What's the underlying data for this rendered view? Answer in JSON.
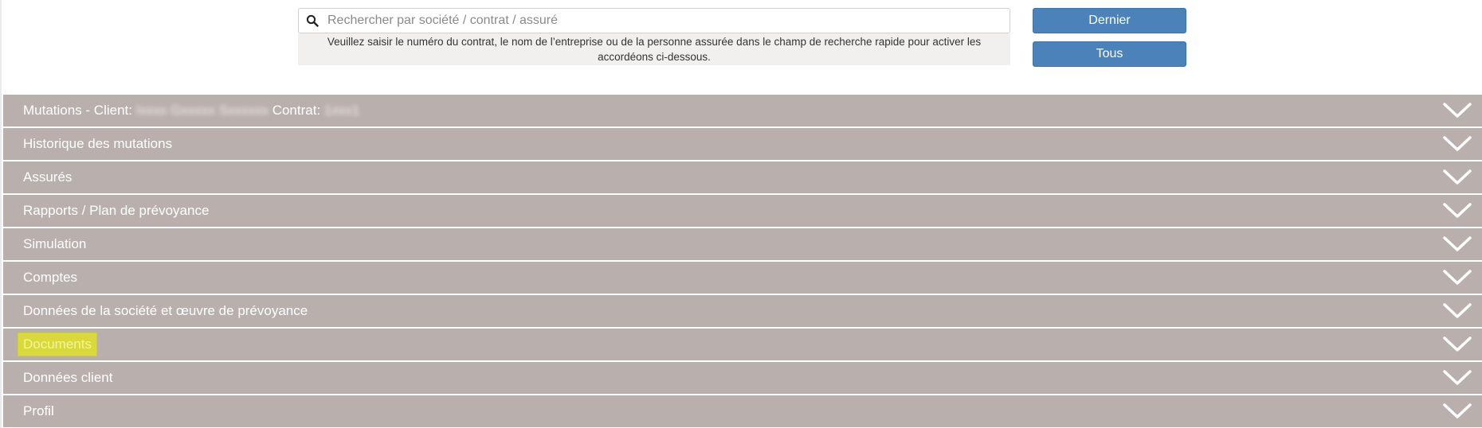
{
  "search": {
    "placeholder": "Rechercher par société / contrat / assuré",
    "value": "",
    "help_text": "Veuillez saisir le numéro du contrat, le nom de l’entreprise ou de la personne assurée dans le champ de recherche rapide pour activer les accordéons ci-dessous."
  },
  "buttons": {
    "last_label": "Dernier",
    "all_label": "Tous"
  },
  "accordions": {
    "items": [
      {
        "prefix": "Mutations - Client: ",
        "client_masked": "Ixxxx Gxxxxx Sxxxxxx",
        "contract_label": " Contrat: ",
        "contract_masked": "1xxx1"
      },
      {
        "label": "Historique des mutations"
      },
      {
        "label": "Assurés"
      },
      {
        "label": "Rapports / Plan de prévoyance"
      },
      {
        "label": "Simulation"
      },
      {
        "label": "Comptes"
      },
      {
        "label": "Données de la société et œuvre de prévoyance"
      },
      {
        "label": "Documents",
        "highlighted": true,
        "highlight_color": "#d9d93b"
      },
      {
        "label": "Données client"
      },
      {
        "label": "Profil"
      }
    ]
  },
  "colors": {
    "accordion_bg": "#b9b0ad",
    "button_bg": "#4a82b9",
    "help_bg": "#f1f0ef"
  },
  "icons": {
    "search": "search-icon",
    "expand": "chevron-down-icon"
  }
}
